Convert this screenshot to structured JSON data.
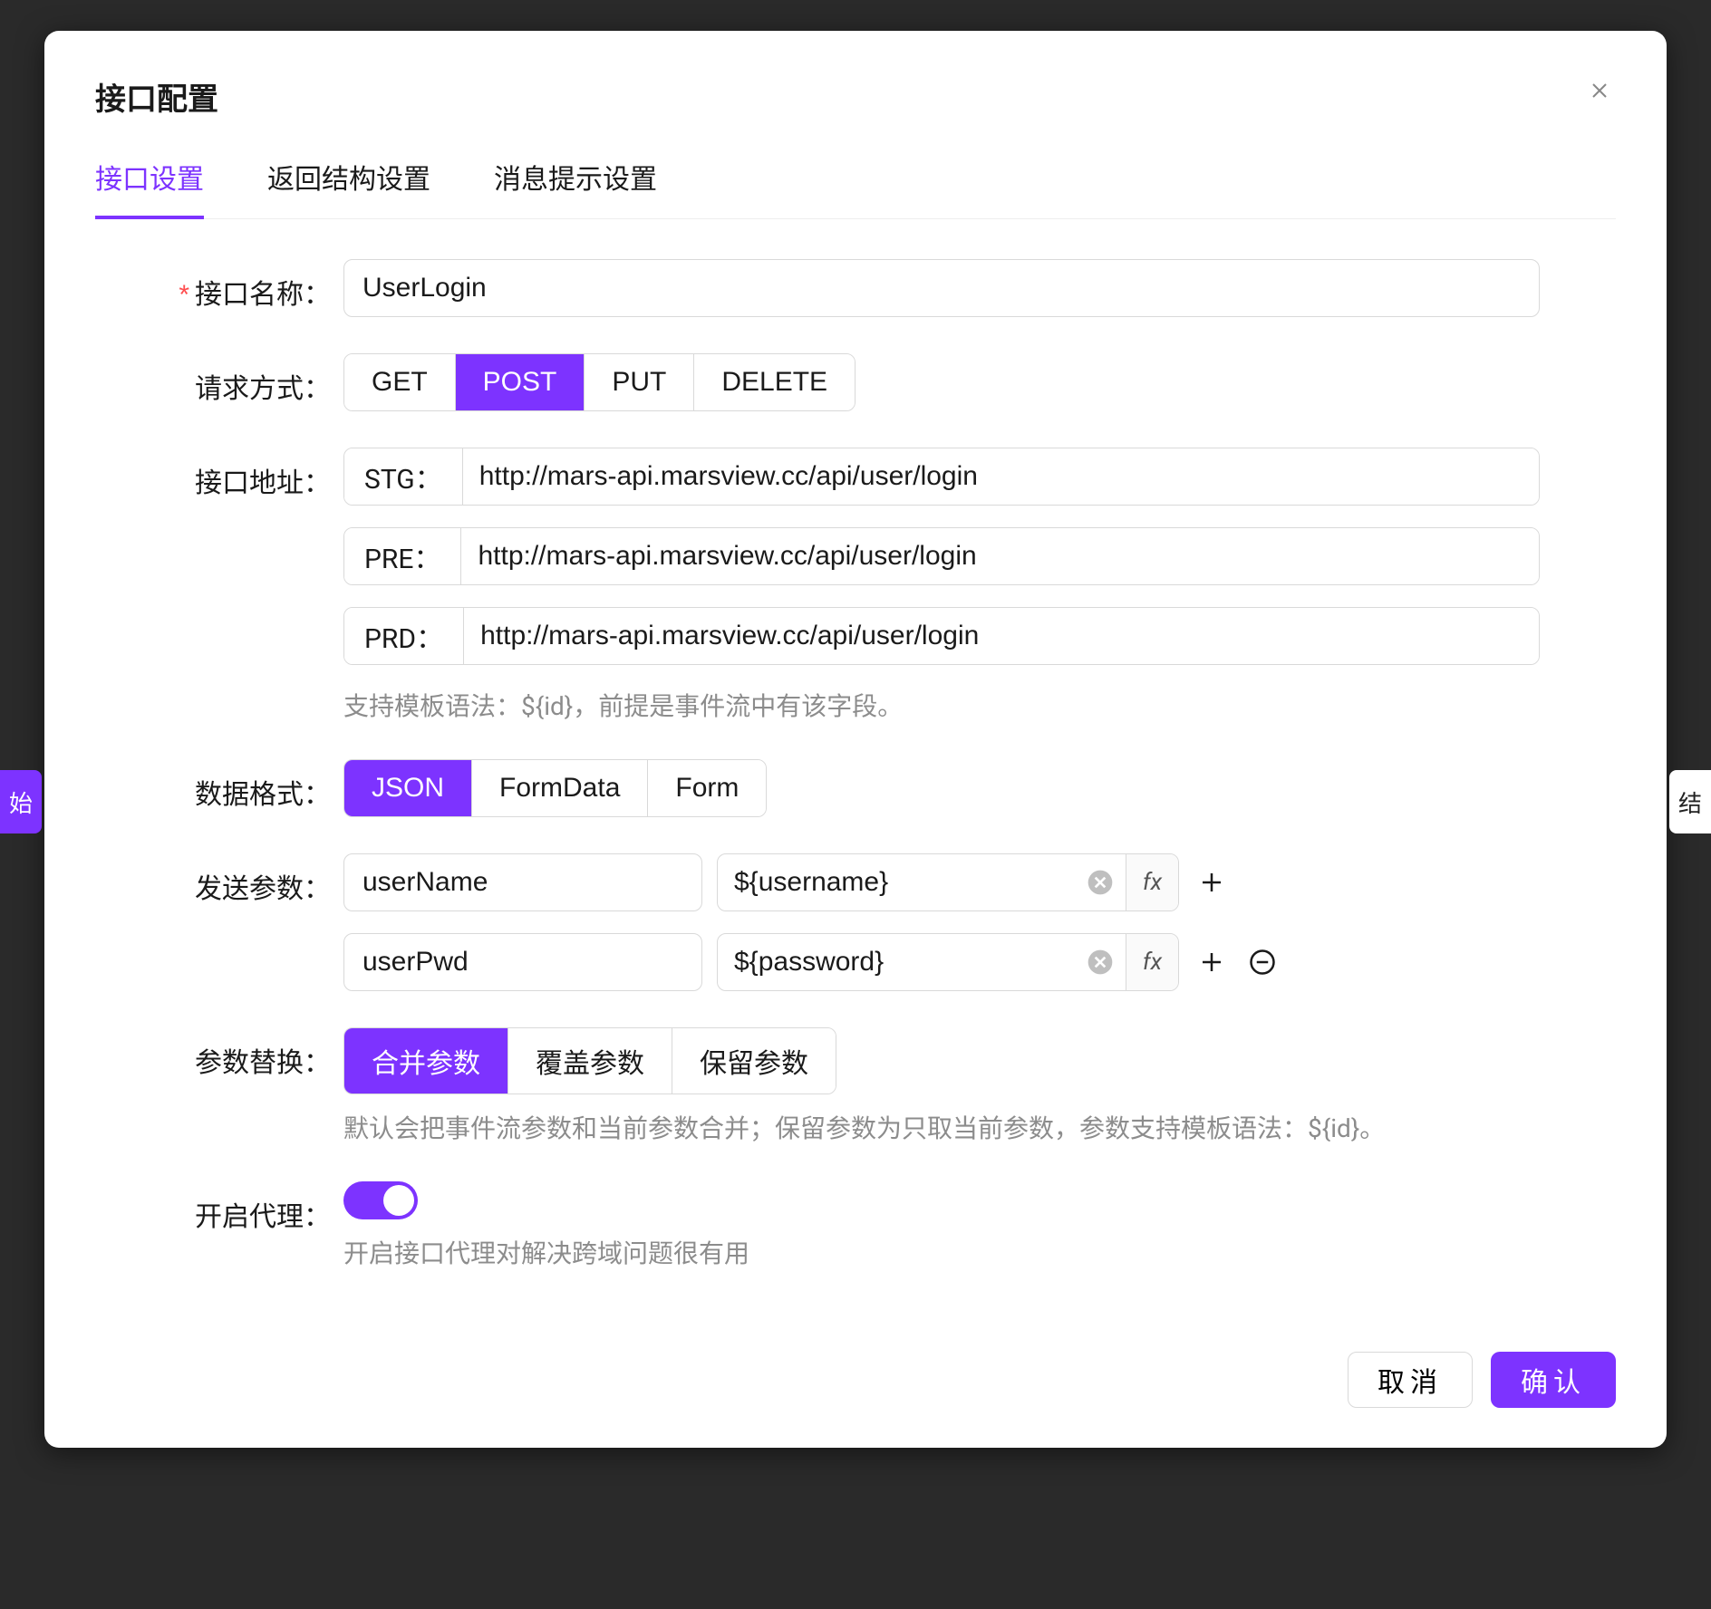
{
  "bg": {
    "left": "始",
    "right": "结"
  },
  "modal": {
    "title": "接口配置",
    "tabs": [
      "接口设置",
      "返回结构设置",
      "消息提示设置"
    ],
    "activeTab": 0,
    "footer": {
      "cancel": "取消",
      "ok": "确认"
    }
  },
  "form": {
    "nameLabel": "接口名称：",
    "nameValue": "UserLogin",
    "methodLabel": "请求方式：",
    "methods": [
      "GET",
      "POST",
      "PUT",
      "DELETE"
    ],
    "methodActive": 1,
    "addressLabel": "接口地址：",
    "addresses": [
      {
        "prefix": "STG：",
        "value": "http://mars-api.marsview.cc/api/user/login"
      },
      {
        "prefix": "PRE：",
        "value": "http://mars-api.marsview.cc/api/user/login"
      },
      {
        "prefix": "PRD：",
        "value": "http://mars-api.marsview.cc/api/user/login"
      }
    ],
    "addressHint": "支持模板语法：${id}，前提是事件流中有该字段。",
    "formatLabel": "数据格式：",
    "formats": [
      "JSON",
      "FormData",
      "Form"
    ],
    "formatActive": 0,
    "paramsLabel": "发送参数：",
    "fxLabel": "fx",
    "params": [
      {
        "key": "userName",
        "value": "${username}"
      },
      {
        "key": "userPwd",
        "value": "${password}"
      }
    ],
    "replaceLabel": "参数替换：",
    "replaceOptions": [
      "合并参数",
      "覆盖参数",
      "保留参数"
    ],
    "replaceActive": 0,
    "replaceHint": "默认会把事件流参数和当前参数合并；保留参数为只取当前参数，参数支持模板语法：${id}。",
    "proxyLabel": "开启代理：",
    "proxyOn": true,
    "proxyHint": "开启接口代理对解决跨域问题很有用"
  }
}
